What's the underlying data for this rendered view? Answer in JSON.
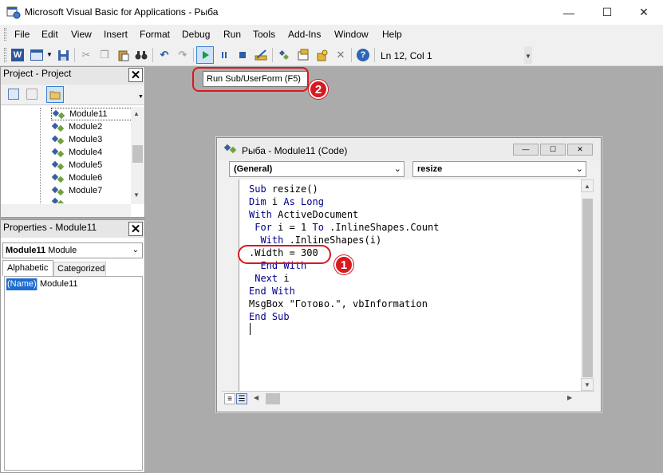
{
  "title": "Microsoft Visual Basic for Applications - Рыба",
  "window_controls": {
    "minimize": "—",
    "maximize": "☐",
    "close": "✕"
  },
  "menu": [
    "File",
    "Edit",
    "View",
    "Insert",
    "Format",
    "Debug",
    "Run",
    "Tools",
    "Add-Ins",
    "Window",
    "Help"
  ],
  "toolbar": {
    "status": "Ln 12, Col 1",
    "tooltip": "Run Sub/UserForm (F5)"
  },
  "project_panel": {
    "title": "Project - Project",
    "modules": [
      "Module11",
      "Module2",
      "Module3",
      "Module4",
      "Module5",
      "Module6",
      "Module7"
    ]
  },
  "properties_panel": {
    "title": "Properties - Module11",
    "object_name": "Module11",
    "object_type": "Module",
    "tabs": [
      "Alphabetic",
      "Categorized"
    ],
    "prop_name": "(Name)",
    "prop_value": "Module11"
  },
  "code_window": {
    "title": "Рыба - Module11 (Code)",
    "object_dropdown": "(General)",
    "proc_dropdown": "resize",
    "lines": [
      [
        {
          "t": "Sub",
          "k": 1
        },
        {
          "t": " resize()"
        }
      ],
      [
        {
          "t": "Dim",
          "k": 1
        },
        {
          "t": " i "
        },
        {
          "t": "As Long",
          "k": 1
        }
      ],
      [
        {
          "t": "With",
          "k": 1
        },
        {
          "t": " ActiveDocument"
        }
      ],
      [
        {
          "t": " "
        },
        {
          "t": "For",
          "k": 1
        },
        {
          "t": " i = 1 "
        },
        {
          "t": "To",
          "k": 1
        },
        {
          "t": " .InlineShapes.Count"
        }
      ],
      [
        {
          "t": "  "
        },
        {
          "t": "With",
          "k": 1
        },
        {
          "t": " .InlineShapes(i)"
        }
      ],
      [
        {
          "t": ".Width = 300"
        }
      ],
      [
        {
          "t": "  "
        },
        {
          "t": "End With",
          "k": 1
        }
      ],
      [
        {
          "t": " "
        },
        {
          "t": "Next",
          "k": 1
        },
        {
          "t": " i"
        }
      ],
      [
        {
          "t": "End With",
          "k": 1
        }
      ],
      [
        {
          "t": "MsgBox \"Готово.\", vbInformation"
        }
      ],
      [
        {
          "t": "End Sub",
          "k": 1
        }
      ]
    ]
  },
  "badges": {
    "one": "1",
    "two": "2"
  },
  "colors": {
    "annotation_red": "#d71920",
    "keyword_blue": "#00008b",
    "play_green": "#1a9b3c"
  }
}
